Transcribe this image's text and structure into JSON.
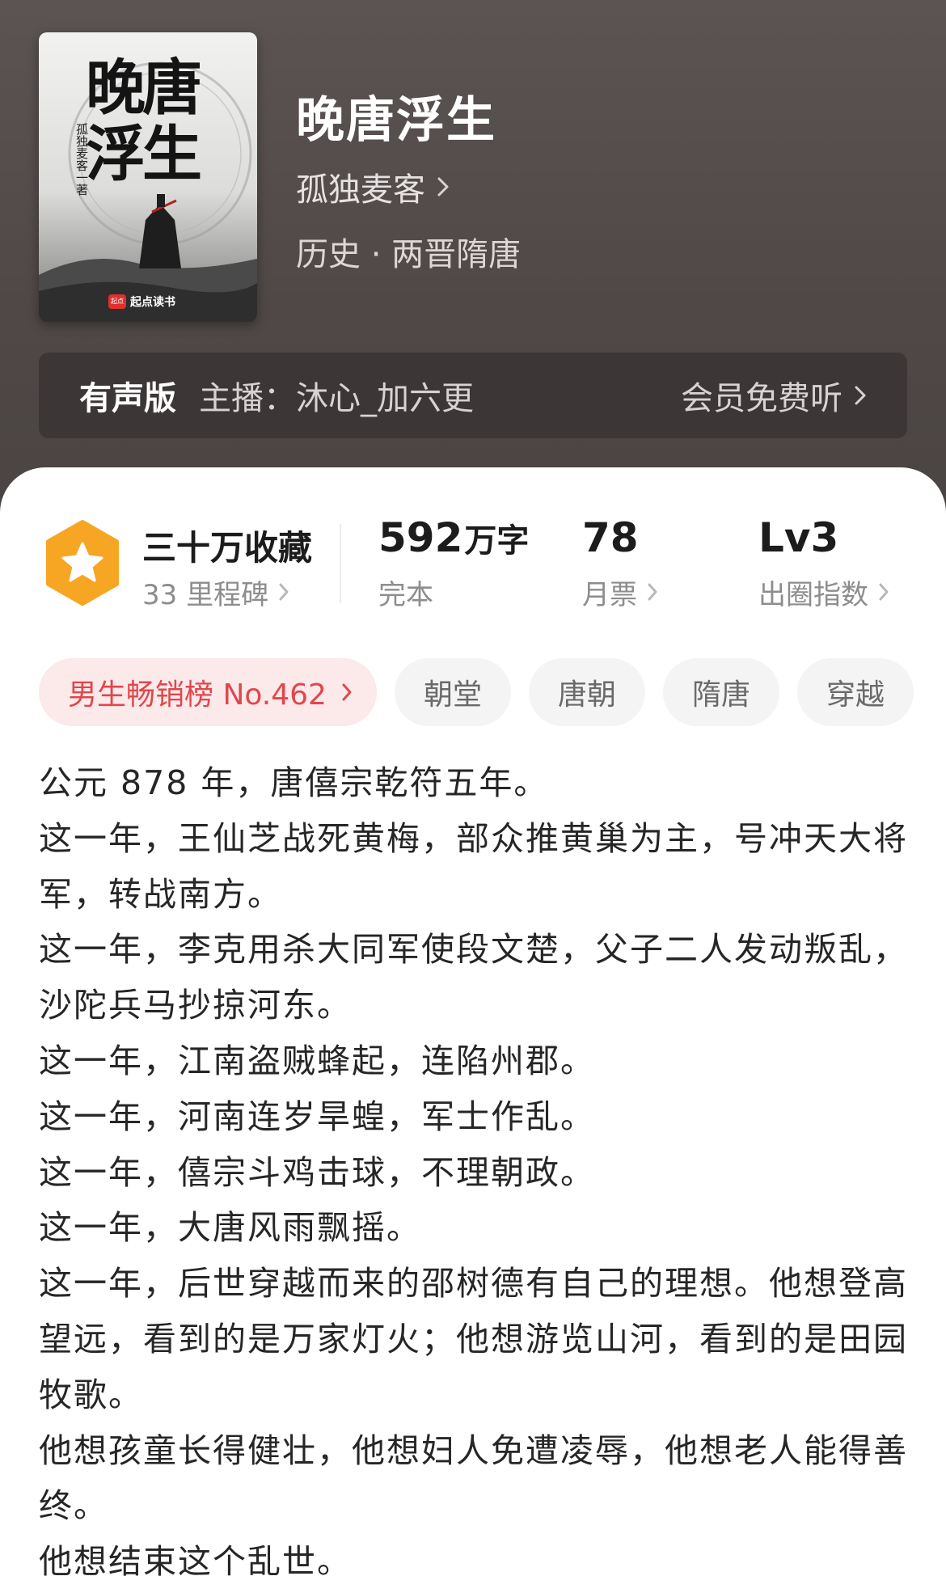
{
  "book": {
    "title": "晚唐浮生",
    "author": "孤独麦客",
    "category": "历史 · 两晋隋唐"
  },
  "cover": {
    "title_text": "晚唐浮生",
    "author_text": "孤独麦客一著",
    "brand_badge": "起点",
    "brand": "起点读书"
  },
  "audio": {
    "label": "有声版",
    "host": "主播：沐心_加六更",
    "cta": "会员免费听"
  },
  "stats": {
    "favorites": "三十万收藏",
    "milestones": "33 里程碑",
    "word_count_number": "592",
    "word_count_unit": "万字",
    "status": "完本",
    "monthly_votes": "78",
    "monthly_votes_label": "月票",
    "level": "Lv3",
    "level_label": "出圈指数"
  },
  "tags": {
    "rank": "男生畅销榜 No.462",
    "items": [
      "朝堂",
      "唐朝",
      "隋唐",
      "穿越"
    ]
  },
  "description": [
    "公元 878 年，唐僖宗乾符五年。",
    "这一年，王仙芝战死黄梅，部众推黄巢为主，号冲天大将军，转战南方。",
    "这一年，李克用杀大同军使段文楚，父子二人发动叛乱，沙陀兵马抄掠河东。",
    "这一年，江南盗贼蜂起，连陷州郡。",
    "这一年，河南连岁旱蝗，军士作乱。",
    "这一年，僖宗斗鸡击球，不理朝政。",
    "这一年，大唐风雨飘摇。",
    "这一年，后世穿越而来的邵树德有自己的理想。他想登高望远，看到的是万家灯火；他想游览山河，看到的是田园牧歌。",
    "他想孩童长得健壮，他想妇人免遭凌辱，他想老人能得善终。",
    "他想结束这个乱世。"
  ],
  "colors": {
    "header_bg": "#5b5453",
    "audio_bg": "#3c3736",
    "rank_tag_bg": "#fce9ea",
    "rank_tag_text": "#e0474c",
    "badge_orange": "#f6a623"
  },
  "icons": {
    "chevron": "chevron-right-icon",
    "badge": "star-hexagon-icon"
  }
}
